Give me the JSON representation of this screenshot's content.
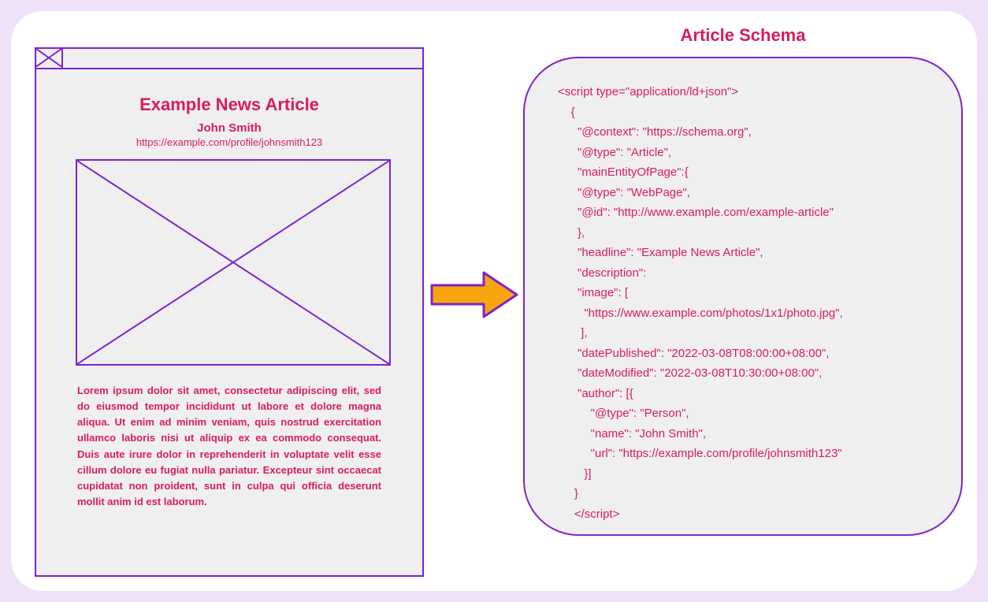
{
  "article": {
    "title": "Example News Article",
    "author": "John Smith",
    "profile_url": "https://example.com/profile/johnsmith123",
    "body": "Lorem ipsum dolor sit amet, consectetur adipiscing elit, sed do eiusmod tempor incididunt ut labore et dolore magna aliqua. Ut enim ad minim veniam, quis nostrud exercitation ullamco laboris nisi ut aliquip ex ea commodo consequat. Duis aute irure dolor in reprehenderit in voluptate velit esse cillum dolore eu fugiat nulla pariatur. Excepteur sint occaecat cupidatat non proident, sunt in culpa qui officia deserunt mollit anim id est laborum."
  },
  "schema": {
    "title": "Article Schema",
    "code": "<script type=\"application/ld+json\">\n    {\n      \"@context\": \"https://schema.org\",\n      \"@type\": \"Article\",\n      \"mainEntityOfPage\":{\n      \"@type\": \"WebPage\",\n      \"@id\": \"http://www.example.com/example-article\"\n      },\n      \"headline\": \"Example News Article\",\n      \"description\":\n      \"image\": [\n        \"https://www.example.com/photos/1x1/photo.jpg\",\n       ],\n      \"datePublished\": \"2022-03-08T08:00:00+08:00\",\n      \"dateModified\": \"2022-03-08T10:30:00+08:00\",\n      \"author\": [{\n          \"@type\": \"Person\",\n          \"name\": \"John Smith\",\n          \"url\": \"https://example.com/profile/johnsmith123\"\n        }]\n     }\n     </script>"
  }
}
